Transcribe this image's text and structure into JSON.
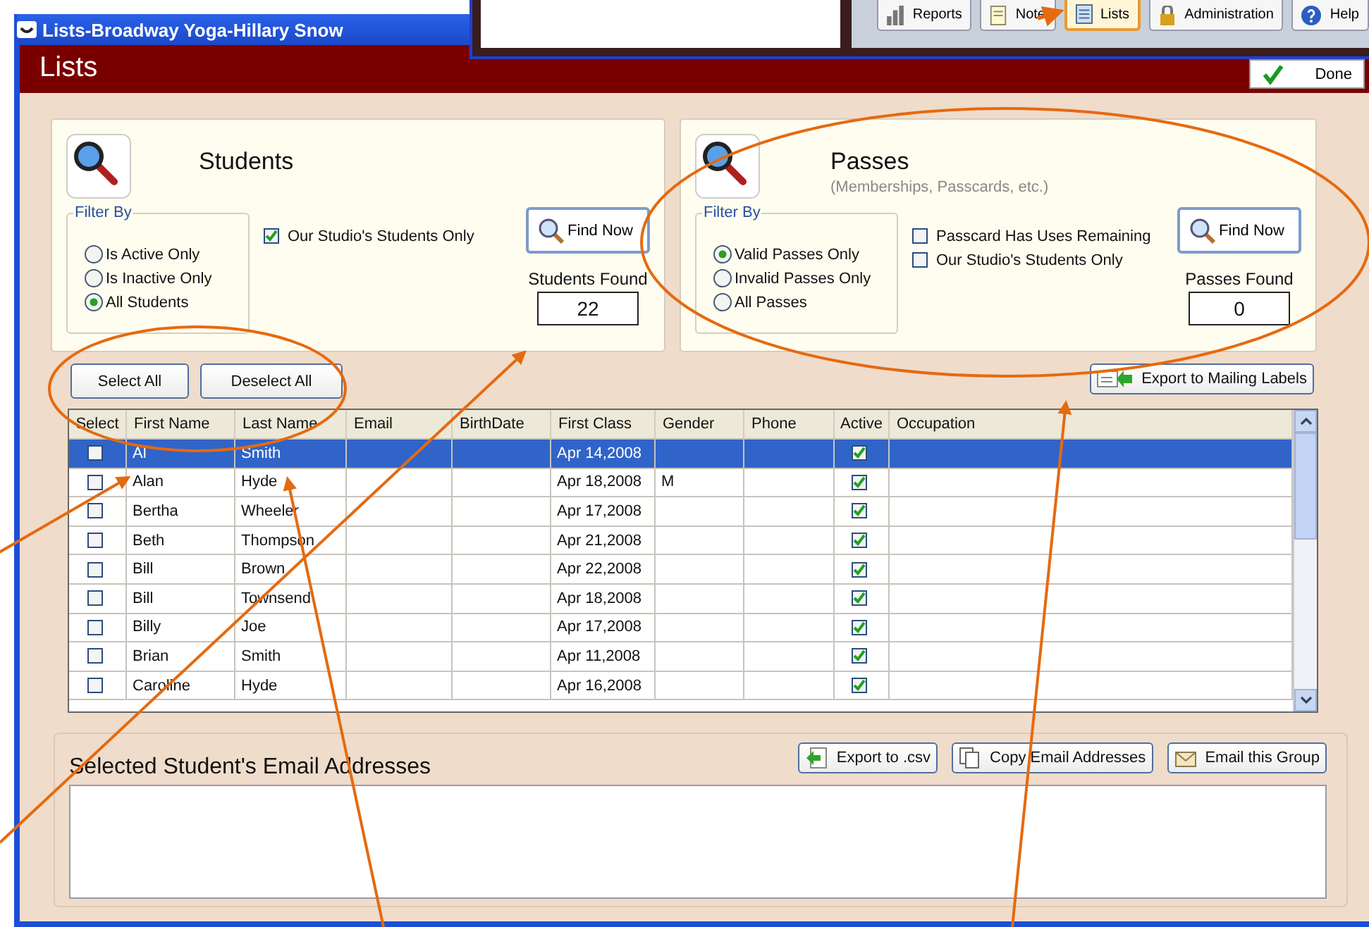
{
  "background_window": {
    "toolbar": [
      {
        "label": "Reports",
        "kind": "chart",
        "selected": false
      },
      {
        "label": "Note",
        "kind": "note",
        "selected": false
      },
      {
        "label": "Lists",
        "kind": "list",
        "selected": true
      },
      {
        "label": "Administration",
        "kind": "lock",
        "selected": false
      },
      {
        "label": "Help",
        "kind": "help",
        "selected": false
      }
    ]
  },
  "window": {
    "title": "Lists-Broadway Yoga-Hillary Snow"
  },
  "header": {
    "title": "Lists",
    "done_button": "Done"
  },
  "students": {
    "title": "Students",
    "filter_label": "Filter By",
    "radios": [
      {
        "label": "Is Active Only",
        "selected": false
      },
      {
        "label": "Is Inactive Only",
        "selected": false
      },
      {
        "label": "All Students",
        "selected": true
      }
    ],
    "checkboxes": [
      {
        "label": "Our Studio's Students Only",
        "checked": true
      }
    ],
    "find_button": "Find Now",
    "found_label": "Students Found",
    "found_value": "22"
  },
  "passes": {
    "title": "Passes",
    "subtitle": "(Memberships, Passcards, etc.)",
    "filter_label": "Filter By",
    "radios": [
      {
        "label": "Valid Passes Only",
        "selected": true
      },
      {
        "label": "Invalid Passes Only",
        "selected": false
      },
      {
        "label": "All Passes",
        "selected": false
      }
    ],
    "checkboxes": [
      {
        "label": "Passcard Has Uses Remaining",
        "checked": false
      },
      {
        "label": "Our Studio's Students Only",
        "checked": false
      }
    ],
    "find_button": "Find Now",
    "found_label": "Passes Found",
    "found_value": "0"
  },
  "list_buttons": [
    "Select All",
    "Deselect All"
  ],
  "export_labels_button": "Export to Mailing Labels",
  "table": {
    "columns": [
      "Select",
      "First Name",
      "Last Name",
      "Email",
      "BirthDate",
      "First Class",
      "Gender",
      "Phone",
      "Active",
      "Occupation"
    ],
    "rows": [
      {
        "selected": true,
        "checked": false,
        "first_name": "Al",
        "last_name": "Smith",
        "first_class": "Apr 14,2008",
        "active": true
      },
      {
        "selected": false,
        "checked": false,
        "first_name": "Alan",
        "last_name": "Hyde",
        "first_class": "Apr 18,2008",
        "gender": "M",
        "active": true
      },
      {
        "selected": false,
        "checked": false,
        "first_name": "Bertha",
        "last_name": "Wheeler",
        "first_class": "Apr 17,2008",
        "active": true
      },
      {
        "selected": false,
        "checked": false,
        "first_name": "Beth",
        "last_name": "Thompson",
        "first_class": "Apr 21,2008",
        "active": true
      },
      {
        "selected": false,
        "checked": false,
        "first_name": "Bill",
        "last_name": "Brown",
        "first_class": "Apr 22,2008",
        "active": true
      },
      {
        "selected": false,
        "checked": false,
        "first_name": "Bill",
        "last_name": "Townsend",
        "first_class": "Apr 18,2008",
        "active": true
      },
      {
        "selected": false,
        "checked": false,
        "first_name": "Billy",
        "last_name": "Joe",
        "first_class": "Apr 17,2008",
        "active": true
      },
      {
        "selected": false,
        "checked": false,
        "first_name": "Brian",
        "last_name": "Smith",
        "first_class": "Apr 11,2008",
        "active": true
      },
      {
        "selected": false,
        "checked": false,
        "first_name": "Caroline",
        "last_name": "Hyde",
        "first_class": "Apr 16,2008",
        "active": true
      }
    ]
  },
  "email_section": {
    "title": "Selected Student's Email Addresses",
    "buttons": [
      {
        "label": "Export to .csv",
        "kind": "export"
      },
      {
        "label": "Copy Email Addresses",
        "kind": "copy"
      },
      {
        "label": "Email this Group",
        "kind": "email"
      }
    ]
  }
}
